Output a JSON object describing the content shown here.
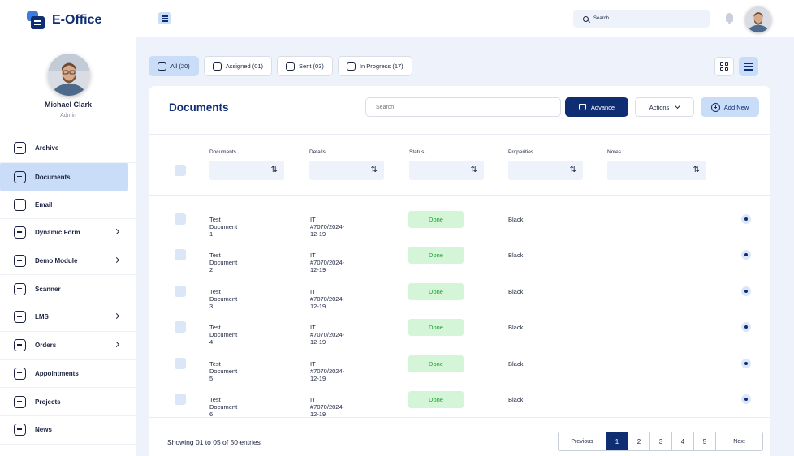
{
  "app": {
    "name": "E-Office"
  },
  "user": {
    "name": "Michael Clark",
    "role": "Admin"
  },
  "sidebar": {
    "items": [
      {
        "label": "Archive",
        "icon": "archive-icon",
        "chevron": false,
        "active": false
      },
      {
        "label": "Documents",
        "icon": "document-icon",
        "chevron": false,
        "active": true
      },
      {
        "label": "Email",
        "icon": "email-icon",
        "chevron": false,
        "active": false
      },
      {
        "label": "Dynamic Form",
        "icon": "form-icon",
        "chevron": true,
        "active": false
      },
      {
        "label": "Demo Module",
        "icon": "module-icon",
        "chevron": true,
        "active": false
      },
      {
        "label": "Scanner",
        "icon": "scanner-icon",
        "chevron": false,
        "active": false
      },
      {
        "label": "LMS",
        "icon": "lms-icon",
        "chevron": true,
        "active": false
      },
      {
        "label": "Orders",
        "icon": "orders-icon",
        "chevron": true,
        "active": false
      },
      {
        "label": "Appointments",
        "icon": "calendar-icon",
        "chevron": false,
        "active": false
      },
      {
        "label": "Projects",
        "icon": "projects-icon",
        "chevron": false,
        "active": false
      },
      {
        "label": "News",
        "icon": "news-icon",
        "chevron": false,
        "active": false
      }
    ]
  },
  "topbar": {
    "search_placeholder": "Search"
  },
  "filters": [
    {
      "label": "All (20)",
      "active": true
    },
    {
      "label": "Assigned (01)",
      "active": false
    },
    {
      "label": "Sent (03)",
      "active": false
    },
    {
      "label": "In Progress (17)",
      "active": false
    }
  ],
  "card": {
    "title": "Documents",
    "search_placeholder": "Search",
    "advance_label": "Advance",
    "actions_label": "Actions",
    "add_label": "Add New"
  },
  "table": {
    "columns": [
      "Documents",
      "Details",
      "Status",
      "Properities",
      "Notes"
    ],
    "sort_glyph": "⇅",
    "rows": [
      {
        "document": "Test Document 1",
        "details": "IT #7070/2024-12-19",
        "status": "Done",
        "property": "Black"
      },
      {
        "document": "Test Document 2",
        "details": "IT #7070/2024-12-19",
        "status": "Done",
        "property": "Black"
      },
      {
        "document": "Test Document 3",
        "details": "IT #7070/2024-12-19",
        "status": "Done",
        "property": "Black"
      },
      {
        "document": "Test Document 4",
        "details": "IT #7070/2024-12-19",
        "status": "Done",
        "property": "Black"
      },
      {
        "document": "Test Document 5",
        "details": "IT #7070/2024-12-19",
        "status": "Done",
        "property": "Black"
      },
      {
        "document": "Test Document 6",
        "details": "IT #7070/2024-12-19",
        "status": "Done",
        "property": "Black"
      }
    ]
  },
  "pagination": {
    "showing": "Showing 01 to 05 of 50 entries",
    "previous": "Previous",
    "next": "Next",
    "pages": [
      "1",
      "2",
      "3",
      "4",
      "5"
    ],
    "current": "1"
  },
  "colors": {
    "primary": "#0f2d73",
    "accent_light": "#c9dcf8",
    "success_bg": "#d5f5d8",
    "success_text": "#22a033"
  }
}
